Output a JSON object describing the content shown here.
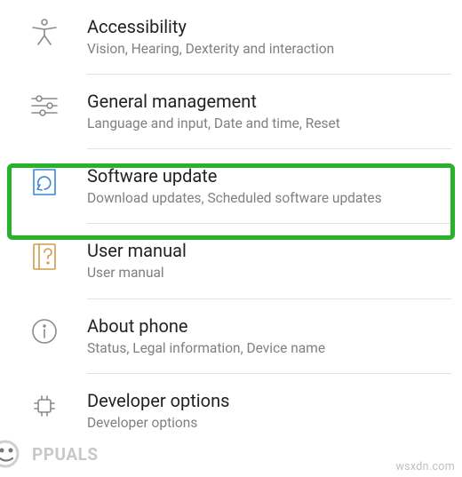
{
  "settings": {
    "items": [
      {
        "icon": "accessibility-icon",
        "title": "Accessibility",
        "subtitle": "Vision, Hearing, Dexterity and interaction"
      },
      {
        "icon": "sliders-icon",
        "title": "General management",
        "subtitle": "Language and input, Date and time, Reset"
      },
      {
        "icon": "update-icon",
        "title": "Software update",
        "subtitle": "Download updates, Scheduled software updates"
      },
      {
        "icon": "manual-icon",
        "title": "User manual",
        "subtitle": "User manual"
      },
      {
        "icon": "info-icon",
        "title": "About phone",
        "subtitle": "Status, Legal information, Device name"
      },
      {
        "icon": "developer-icon",
        "title": "Developer options",
        "subtitle": "Developer options"
      }
    ]
  },
  "watermark_left": "PPUALS",
  "watermark_right": "wsxdn.com",
  "highlight_index": 2
}
